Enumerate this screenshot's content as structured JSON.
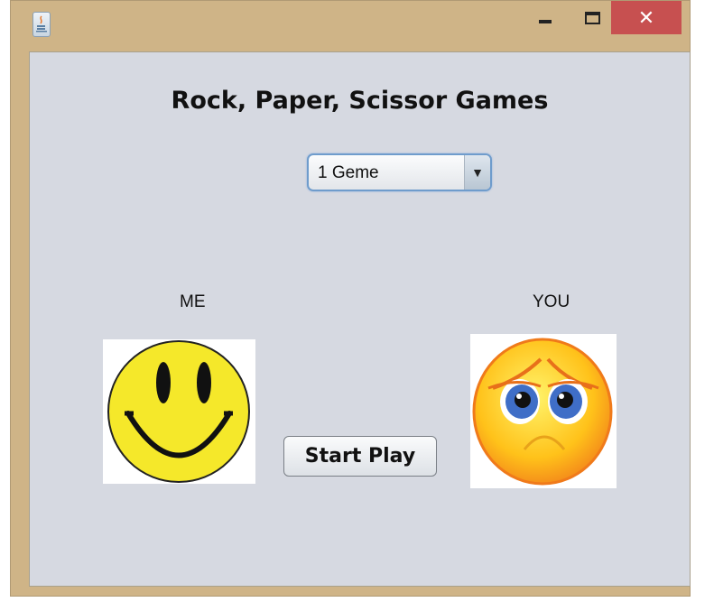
{
  "window": {
    "icon": "java-coffee-icon",
    "title_bar_color": "#cfb487",
    "close_color": "#c75050"
  },
  "controls": {
    "minimize": "minimize-icon",
    "maximize": "maximize-icon",
    "close_label": "✕"
  },
  "main": {
    "title": "Rock, Paper, Scissor Games",
    "game_select": {
      "value": "1 Geme",
      "arrow": "▼"
    },
    "player_me": {
      "label": "ME",
      "image": "happy-smiley-face"
    },
    "player_you": {
      "label": "YOU",
      "image": "sad-crying-face"
    },
    "start_button": "Start Play"
  }
}
